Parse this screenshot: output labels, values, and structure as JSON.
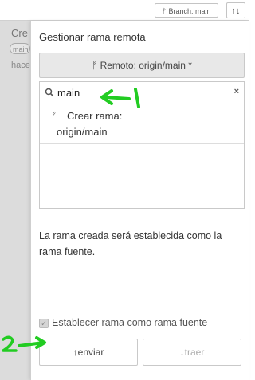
{
  "background": {
    "title": "Cre",
    "badge": "main",
    "time": "hace"
  },
  "topbar": {
    "branch_glyph": "ᚠ",
    "branch_label": "Branch: main",
    "sync_glyph": "↑↓"
  },
  "panel": {
    "title": "Gestionar rama remota",
    "remote_button": "ᚠ Remoto: origin/main *",
    "search": {
      "value": "main",
      "clear_glyph": "×"
    },
    "results": [
      {
        "glyph": "ᚠ",
        "line1": "Crear rama:",
        "line2": "origin/main"
      }
    ],
    "info": "La rama creada será establecida como la rama fuente.",
    "checkbox": {
      "checked": true,
      "label": "Establecer rama como rama fuente"
    },
    "push_button": "↑enviar",
    "pull_button": "↓traer"
  },
  "annotations": {
    "color": "#22cc22",
    "label_1": "1",
    "label_2": "2"
  }
}
